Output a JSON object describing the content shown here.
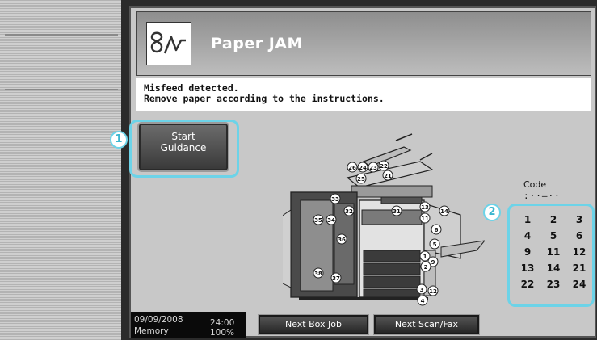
{
  "header": {
    "title": "Paper JAM",
    "icon": "jam-icon"
  },
  "message": {
    "line1": "Misfeed detected.",
    "line2": "Remove paper according to the instructions."
  },
  "guidance": {
    "start_line1": "Start",
    "start_line2": "Guidance",
    "callout": "1"
  },
  "code": {
    "label": "Code",
    "value": ":··–··"
  },
  "jam_positions": {
    "callout": "2",
    "numbers": [
      "1",
      "2",
      "3",
      "4",
      "5",
      "6",
      "9",
      "11",
      "12",
      "13",
      "14",
      "21",
      "22",
      "23",
      "24"
    ]
  },
  "status": {
    "date": "09/09/2008",
    "time": "24:00",
    "memory_label": "Memory",
    "memory_value": "100%"
  },
  "buttons": {
    "next_box": "Next Box Job",
    "next_scan": "Next Scan/Fax"
  },
  "diagram_labels": [
    "26",
    "24",
    "23",
    "22",
    "25",
    "21",
    "31",
    "32",
    "33",
    "35",
    "34",
    "36",
    "37",
    "38",
    "13",
    "11",
    "14",
    "6",
    "5",
    "1",
    "9",
    "2",
    "3",
    "12",
    "4"
  ],
  "colors": {
    "highlight": "#6cd3e8",
    "header": "#9a9a9a"
  }
}
